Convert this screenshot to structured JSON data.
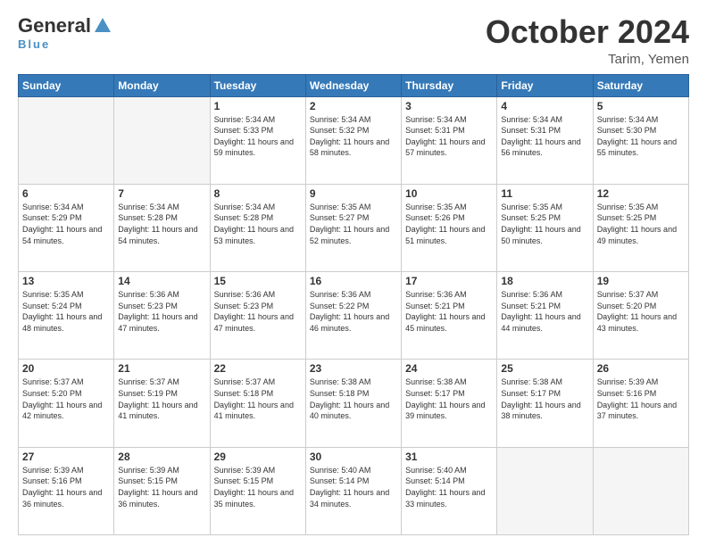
{
  "logo": {
    "general": "General",
    "blue": "Blue"
  },
  "header": {
    "month": "October 2024",
    "location": "Tarim, Yemen"
  },
  "weekdays": [
    "Sunday",
    "Monday",
    "Tuesday",
    "Wednesday",
    "Thursday",
    "Friday",
    "Saturday"
  ],
  "weeks": [
    [
      {
        "day": "",
        "empty": true
      },
      {
        "day": "",
        "empty": true
      },
      {
        "day": "1",
        "sunrise": "5:34 AM",
        "sunset": "5:33 PM",
        "daylight": "11 hours and 59 minutes."
      },
      {
        "day": "2",
        "sunrise": "5:34 AM",
        "sunset": "5:32 PM",
        "daylight": "11 hours and 58 minutes."
      },
      {
        "day": "3",
        "sunrise": "5:34 AM",
        "sunset": "5:31 PM",
        "daylight": "11 hours and 57 minutes."
      },
      {
        "day": "4",
        "sunrise": "5:34 AM",
        "sunset": "5:31 PM",
        "daylight": "11 hours and 56 minutes."
      },
      {
        "day": "5",
        "sunrise": "5:34 AM",
        "sunset": "5:30 PM",
        "daylight": "11 hours and 55 minutes."
      }
    ],
    [
      {
        "day": "6",
        "sunrise": "5:34 AM",
        "sunset": "5:29 PM",
        "daylight": "11 hours and 54 minutes."
      },
      {
        "day": "7",
        "sunrise": "5:34 AM",
        "sunset": "5:28 PM",
        "daylight": "11 hours and 54 minutes."
      },
      {
        "day": "8",
        "sunrise": "5:34 AM",
        "sunset": "5:28 PM",
        "daylight": "11 hours and 53 minutes."
      },
      {
        "day": "9",
        "sunrise": "5:35 AM",
        "sunset": "5:27 PM",
        "daylight": "11 hours and 52 minutes."
      },
      {
        "day": "10",
        "sunrise": "5:35 AM",
        "sunset": "5:26 PM",
        "daylight": "11 hours and 51 minutes."
      },
      {
        "day": "11",
        "sunrise": "5:35 AM",
        "sunset": "5:25 PM",
        "daylight": "11 hours and 50 minutes."
      },
      {
        "day": "12",
        "sunrise": "5:35 AM",
        "sunset": "5:25 PM",
        "daylight": "11 hours and 49 minutes."
      }
    ],
    [
      {
        "day": "13",
        "sunrise": "5:35 AM",
        "sunset": "5:24 PM",
        "daylight": "11 hours and 48 minutes."
      },
      {
        "day": "14",
        "sunrise": "5:36 AM",
        "sunset": "5:23 PM",
        "daylight": "11 hours and 47 minutes."
      },
      {
        "day": "15",
        "sunrise": "5:36 AM",
        "sunset": "5:23 PM",
        "daylight": "11 hours and 47 minutes."
      },
      {
        "day": "16",
        "sunrise": "5:36 AM",
        "sunset": "5:22 PM",
        "daylight": "11 hours and 46 minutes."
      },
      {
        "day": "17",
        "sunrise": "5:36 AM",
        "sunset": "5:21 PM",
        "daylight": "11 hours and 45 minutes."
      },
      {
        "day": "18",
        "sunrise": "5:36 AM",
        "sunset": "5:21 PM",
        "daylight": "11 hours and 44 minutes."
      },
      {
        "day": "19",
        "sunrise": "5:37 AM",
        "sunset": "5:20 PM",
        "daylight": "11 hours and 43 minutes."
      }
    ],
    [
      {
        "day": "20",
        "sunrise": "5:37 AM",
        "sunset": "5:20 PM",
        "daylight": "11 hours and 42 minutes."
      },
      {
        "day": "21",
        "sunrise": "5:37 AM",
        "sunset": "5:19 PM",
        "daylight": "11 hours and 41 minutes."
      },
      {
        "day": "22",
        "sunrise": "5:37 AM",
        "sunset": "5:18 PM",
        "daylight": "11 hours and 41 minutes."
      },
      {
        "day": "23",
        "sunrise": "5:38 AM",
        "sunset": "5:18 PM",
        "daylight": "11 hours and 40 minutes."
      },
      {
        "day": "24",
        "sunrise": "5:38 AM",
        "sunset": "5:17 PM",
        "daylight": "11 hours and 39 minutes."
      },
      {
        "day": "25",
        "sunrise": "5:38 AM",
        "sunset": "5:17 PM",
        "daylight": "11 hours and 38 minutes."
      },
      {
        "day": "26",
        "sunrise": "5:39 AM",
        "sunset": "5:16 PM",
        "daylight": "11 hours and 37 minutes."
      }
    ],
    [
      {
        "day": "27",
        "sunrise": "5:39 AM",
        "sunset": "5:16 PM",
        "daylight": "11 hours and 36 minutes."
      },
      {
        "day": "28",
        "sunrise": "5:39 AM",
        "sunset": "5:15 PM",
        "daylight": "11 hours and 36 minutes."
      },
      {
        "day": "29",
        "sunrise": "5:39 AM",
        "sunset": "5:15 PM",
        "daylight": "11 hours and 35 minutes."
      },
      {
        "day": "30",
        "sunrise": "5:40 AM",
        "sunset": "5:14 PM",
        "daylight": "11 hours and 34 minutes."
      },
      {
        "day": "31",
        "sunrise": "5:40 AM",
        "sunset": "5:14 PM",
        "daylight": "11 hours and 33 minutes."
      },
      {
        "day": "",
        "empty": true
      },
      {
        "day": "",
        "empty": true
      }
    ]
  ]
}
